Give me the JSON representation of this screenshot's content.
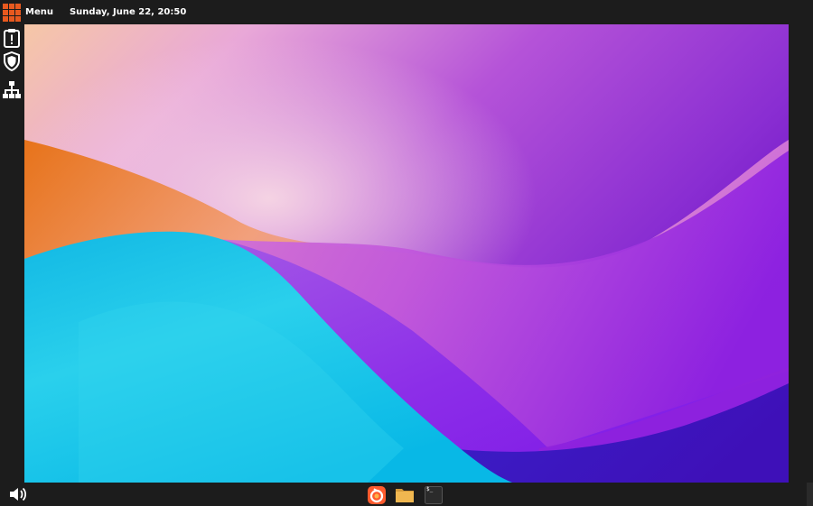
{
  "topbar": {
    "menu_label": "Menu",
    "menu_icon": "grid-menu-icon",
    "clock": "Sunday, June 22, 20:50",
    "accent_color": "#e8591f"
  },
  "sidebar": {
    "items": [
      {
        "name": "clipboard-alert-icon"
      },
      {
        "name": "shield-icon"
      },
      {
        "name": "network-icon"
      }
    ]
  },
  "bottombar": {
    "volume_icon": "volume-icon",
    "dock": [
      {
        "name": "firefox-icon",
        "color": "#ff5b2e"
      },
      {
        "name": "files-icon",
        "color": "#f0b750"
      },
      {
        "name": "terminal-icon",
        "color": "#2b2b2b"
      }
    ],
    "terminal_glyph": "$_"
  },
  "colors": {
    "panel": "#1c1c1c",
    "wallpaper_purple": "#8e2de2",
    "wallpaper_cyan": "#0fc2e6",
    "wallpaper_orange": "#f2962e"
  }
}
